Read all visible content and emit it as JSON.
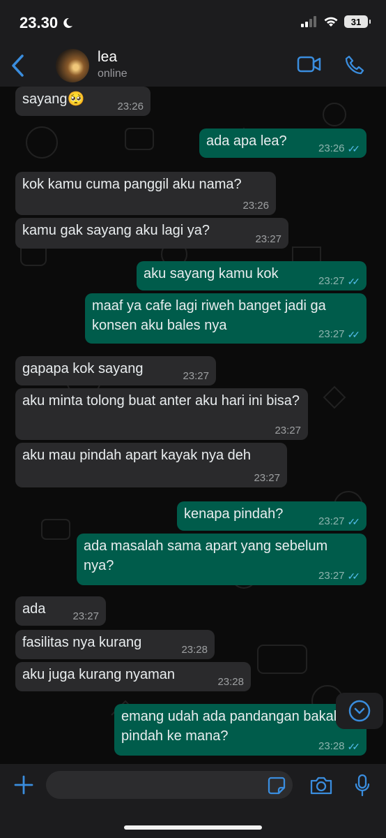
{
  "status_bar": {
    "time": "23.30",
    "battery": "31"
  },
  "header": {
    "contact_name": "lea",
    "contact_status": "online"
  },
  "messages": [
    {
      "dir": "in",
      "text": "sayang🥺",
      "time": "23:26"
    },
    {
      "dir": "out",
      "text": "ada apa lea?",
      "time": "23:26"
    },
    {
      "dir": "in",
      "text": "kok kamu cuma panggil aku nama?",
      "time": "23:26"
    },
    {
      "dir": "in",
      "text": "kamu gak sayang aku lagi ya?",
      "time": "23:27"
    },
    {
      "dir": "out",
      "text": "aku sayang kamu kok",
      "time": "23:27"
    },
    {
      "dir": "out",
      "text": "maaf ya cafe lagi riweh banget jadi ga konsen aku bales nya",
      "time": "23:27"
    },
    {
      "dir": "in",
      "text": "gapapa kok sayang",
      "time": "23:27"
    },
    {
      "dir": "in",
      "text": "aku minta tolong buat anter aku hari ini bisa?",
      "time": "23:27"
    },
    {
      "dir": "in",
      "text": "aku mau pindah apart kayak nya deh",
      "time": "23:27"
    },
    {
      "dir": "out",
      "text": "kenapa pindah?",
      "time": "23:27"
    },
    {
      "dir": "out",
      "text": "ada masalah sama apart yang sebelum nya?",
      "time": "23:27"
    },
    {
      "dir": "in",
      "text": "ada",
      "time": "23:27"
    },
    {
      "dir": "in",
      "text": "fasilitas nya kurang",
      "time": "23:28"
    },
    {
      "dir": "in",
      "text": "aku juga kurang nyaman",
      "time": "23:28"
    },
    {
      "dir": "out",
      "text": "emang udah ada pandangan bakal pindah ke mana?",
      "time": "23:28"
    }
  ],
  "input": {
    "placeholder": ""
  },
  "colors": {
    "outgoing": "#005c4b",
    "incoming": "#2a2a2c",
    "accent": "#3a8dde",
    "read_tick": "#53bdeb"
  },
  "icons": [
    "back-chevron-icon",
    "video-call-icon",
    "phone-icon",
    "plus-icon",
    "sticker-icon",
    "camera-icon",
    "mic-icon",
    "scroll-down-icon",
    "moon-icon",
    "signal-icon",
    "wifi-icon"
  ]
}
